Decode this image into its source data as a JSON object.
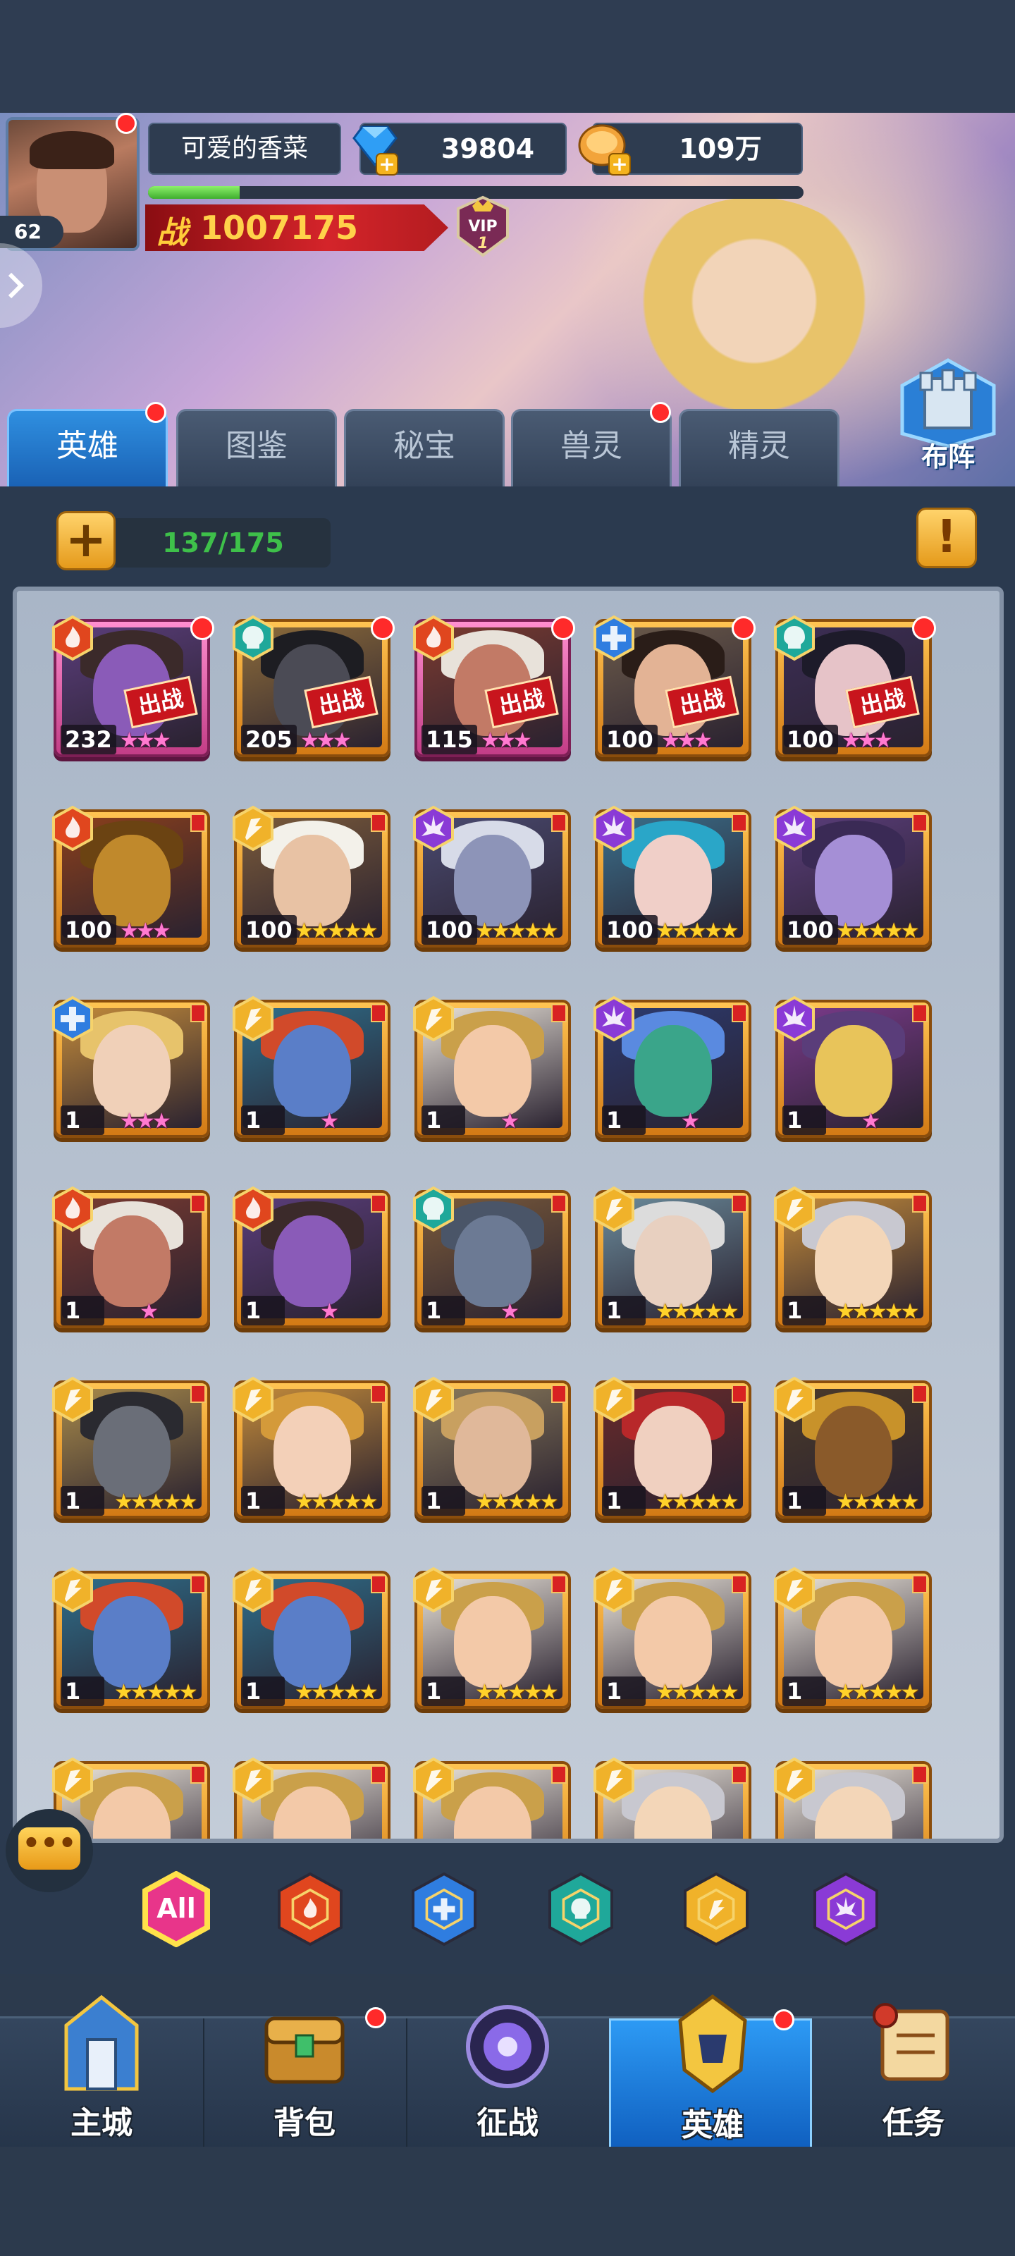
{
  "player": {
    "name": "可爱的香菜",
    "level": "62",
    "diamonds": "39804",
    "gold": "109万",
    "power_label": "战",
    "power": "1007175",
    "vip_label": "VIP",
    "vip_level": "1",
    "xp_progress": 0.14
  },
  "formation_label": "布阵",
  "tabs": [
    {
      "label": "英雄",
      "active": true,
      "badge": true
    },
    {
      "label": "图鉴",
      "active": false,
      "badge": false
    },
    {
      "label": "秘宝",
      "active": false,
      "badge": false
    },
    {
      "label": "兽灵",
      "active": false,
      "badge": true
    },
    {
      "label": "精灵",
      "active": false,
      "badge": false
    }
  ],
  "collection": {
    "add_label": "+",
    "count": "137/175",
    "info_label": "!"
  },
  "deploy_label": "出战",
  "heroes": [
    {
      "level": "232",
      "faction": "fire",
      "stars": 3,
      "star_color": "pink",
      "deployed": true,
      "dot": true,
      "frame": "purple",
      "skin": "#8a5bb8",
      "hair": "#3b2a2a",
      "bg": "#5a3d7a"
    },
    {
      "level": "205",
      "faction": "undead",
      "stars": 3,
      "star_color": "pink",
      "deployed": true,
      "dot": true,
      "frame": "gold",
      "skin": "#4b4b55",
      "hair": "#1d1d22",
      "bg": "#8c6b3a"
    },
    {
      "level": "115",
      "faction": "fire",
      "stars": 3,
      "star_color": "pink",
      "deployed": true,
      "dot": true,
      "frame": "purple",
      "skin": "#c27a66",
      "hair": "#e8e2da",
      "bg": "#7a3a30"
    },
    {
      "level": "100",
      "faction": "storm",
      "stars": 3,
      "star_color": "pink",
      "deployed": true,
      "dot": true,
      "frame": "gold",
      "skin": "#e3b395",
      "hair": "#2a1d18",
      "bg": "#6b5a4a"
    },
    {
      "level": "100",
      "faction": "undead",
      "stars": 3,
      "star_color": "pink",
      "deployed": true,
      "dot": true,
      "frame": "gold",
      "skin": "#e6c3c8",
      "hair": "#1d1b2a",
      "bg": "#3c2e55"
    },
    {
      "level": "100",
      "faction": "fire",
      "stars": 3,
      "star_color": "pink",
      "deployed": false,
      "dot": false,
      "frame": "gold",
      "skin": "#c0892c",
      "hair": "#6b4312",
      "bg": "#8a3f1c"
    },
    {
      "level": "100",
      "faction": "light",
      "stars": 5,
      "star_color": "gold",
      "deployed": false,
      "dot": false,
      "frame": "gold",
      "skin": "#e8c2a4",
      "hair": "#f3f1ea",
      "bg": "#7a5a3a"
    },
    {
      "level": "100",
      "faction": "shadow",
      "stars": 5,
      "star_color": "gold",
      "deployed": false,
      "dot": false,
      "frame": "gold",
      "skin": "#8d94b8",
      "hair": "#d7dbe8",
      "bg": "#4a4a70"
    },
    {
      "level": "100",
      "faction": "shadow",
      "stars": 5,
      "star_color": "gold",
      "deployed": false,
      "dot": false,
      "frame": "gold",
      "skin": "#f0cfc8",
      "hair": "#2aa6c8",
      "bg": "#3a6e8a"
    },
    {
      "level": "100",
      "faction": "shadow",
      "stars": 5,
      "star_color": "gold",
      "deployed": false,
      "dot": false,
      "frame": "gold",
      "skin": "#a58fd6",
      "hair": "#3a2a55",
      "bg": "#5a3d7a"
    },
    {
      "level": "1",
      "faction": "storm",
      "stars": 3,
      "star_color": "pink",
      "deployed": false,
      "dot": false,
      "frame": "gold",
      "skin": "#f0d0b8",
      "hair": "#e7c36b",
      "bg": "#c28a3a"
    },
    {
      "level": "1",
      "faction": "light",
      "stars": 1,
      "star_color": "pink",
      "deployed": false,
      "dot": false,
      "frame": "gold",
      "skin": "#5a7ec8",
      "hair": "#d14a2a",
      "bg": "#2e6e8a"
    },
    {
      "level": "1",
      "faction": "light",
      "stars": 1,
      "star_color": "pink",
      "deployed": false,
      "dot": false,
      "frame": "gold",
      "skin": "#f3c9a8",
      "hair": "#caa04a",
      "bg": "#e8e2d8"
    },
    {
      "level": "1",
      "faction": "shadow",
      "stars": 1,
      "star_color": "pink",
      "deployed": false,
      "dot": false,
      "frame": "gold",
      "skin": "#3aa58a",
      "hair": "#5a8ae0",
      "bg": "#2c3a6e"
    },
    {
      "level": "1",
      "faction": "shadow",
      "stars": 1,
      "star_color": "pink",
      "deployed": false,
      "dot": false,
      "frame": "gold",
      "skin": "#e8c45a",
      "hair": "#5a3d7a",
      "bg": "#7a3a8a"
    },
    {
      "level": "1",
      "faction": "fire",
      "stars": 1,
      "star_color": "pink",
      "deployed": false,
      "dot": false,
      "frame": "gold",
      "skin": "#c27a66",
      "hair": "#e8e2da",
      "bg": "#7a3a30"
    },
    {
      "level": "1",
      "faction": "fire",
      "stars": 1,
      "star_color": "pink",
      "deployed": false,
      "dot": false,
      "frame": "gold",
      "skin": "#8a5bb8",
      "hair": "#3b2a2a",
      "bg": "#5a3d7a"
    },
    {
      "level": "1",
      "faction": "undead",
      "stars": 1,
      "star_color": "pink",
      "deployed": false,
      "dot": false,
      "frame": "gold",
      "skin": "#6c7a94",
      "hair": "#4a5568",
      "bg": "#7a5a3a"
    },
    {
      "level": "1",
      "faction": "light",
      "stars": 5,
      "star_color": "gold",
      "deployed": false,
      "dot": false,
      "frame": "gold",
      "skin": "#e8d0c0",
      "hair": "#dcdcdc",
      "bg": "#6a8a9a"
    },
    {
      "level": "1",
      "faction": "light",
      "stars": 5,
      "star_color": "gold",
      "deployed": false,
      "dot": false,
      "frame": "gold",
      "skin": "#f3d6b8",
      "hair": "#c8c8d0",
      "bg": "#c28a3a"
    },
    {
      "level": "1",
      "faction": "light",
      "stars": 5,
      "star_color": "gold",
      "deployed": false,
      "dot": false,
      "frame": "gold",
      "skin": "#6a6e78",
      "hair": "#2a2a30",
      "bg": "#a88a4a"
    },
    {
      "level": "1",
      "faction": "light",
      "stars": 5,
      "star_color": "gold",
      "deployed": false,
      "dot": false,
      "frame": "gold",
      "skin": "#f3d0b8",
      "hair": "#d49a3a",
      "bg": "#c28a3a"
    },
    {
      "level": "1",
      "faction": "light",
      "stars": 5,
      "star_color": "gold",
      "deployed": false,
      "dot": false,
      "frame": "gold",
      "skin": "#e0b89a",
      "hair": "#c8a060",
      "bg": "#8a7a5a"
    },
    {
      "level": "1",
      "faction": "light",
      "stars": 5,
      "star_color": "gold",
      "deployed": false,
      "dot": false,
      "frame": "gold",
      "skin": "#f0d0c0",
      "hair": "#b8282a",
      "bg": "#6a2a2a"
    },
    {
      "level": "1",
      "faction": "light",
      "stars": 5,
      "star_color": "gold",
      "deployed": false,
      "dot": false,
      "frame": "gold",
      "skin": "#8a5a2a",
      "hair": "#c8922a",
      "bg": "#4a3a2a"
    },
    {
      "level": "1",
      "faction": "light",
      "stars": 5,
      "star_color": "gold",
      "deployed": false,
      "dot": false,
      "frame": "gold",
      "skin": "#5a7ec8",
      "hair": "#d14a2a",
      "bg": "#2e6e8a"
    },
    {
      "level": "1",
      "faction": "light",
      "stars": 5,
      "star_color": "gold",
      "deployed": false,
      "dot": false,
      "frame": "gold",
      "skin": "#5a7ec8",
      "hair": "#d14a2a",
      "bg": "#2e6e8a"
    },
    {
      "level": "1",
      "faction": "light",
      "stars": 5,
      "star_color": "gold",
      "deployed": false,
      "dot": false,
      "frame": "gold",
      "skin": "#f3c9a8",
      "hair": "#caa04a",
      "bg": "#e8e2d8"
    },
    {
      "level": "1",
      "faction": "light",
      "stars": 5,
      "star_color": "gold",
      "deployed": false,
      "dot": false,
      "frame": "gold",
      "skin": "#f3c9a8",
      "hair": "#caa04a",
      "bg": "#e8e2d8"
    },
    {
      "level": "1",
      "faction": "light",
      "stars": 5,
      "star_color": "gold",
      "deployed": false,
      "dot": false,
      "frame": "gold",
      "skin": "#f3c9a8",
      "hair": "#caa04a",
      "bg": "#e8e2d8"
    },
    {
      "level": "",
      "faction": "light",
      "stars": 0,
      "star_color": "gold",
      "deployed": false,
      "dot": false,
      "frame": "gold",
      "skin": "#f3c9a8",
      "hair": "#caa04a",
      "bg": "#e8e2d8"
    },
    {
      "level": "",
      "faction": "light",
      "stars": 0,
      "star_color": "gold",
      "deployed": false,
      "dot": false,
      "frame": "gold",
      "skin": "#f3c9a8",
      "hair": "#caa04a",
      "bg": "#e8e2d8"
    },
    {
      "level": "",
      "faction": "light",
      "stars": 0,
      "star_color": "gold",
      "deployed": false,
      "dot": false,
      "frame": "gold",
      "skin": "#f3c9a8",
      "hair": "#caa04a",
      "bg": "#e8e2d8"
    },
    {
      "level": "",
      "faction": "light",
      "stars": 0,
      "star_color": "gold",
      "deployed": false,
      "dot": false,
      "frame": "gold",
      "skin": "#f3d6b8",
      "hair": "#c8c8d0",
      "bg": "#e8e2d8"
    },
    {
      "level": "",
      "faction": "light",
      "stars": 0,
      "star_color": "gold",
      "deployed": false,
      "dot": false,
      "frame": "gold",
      "skin": "#f3d6b8",
      "hair": "#c8c8d0",
      "bg": "#e8e2d8"
    }
  ],
  "filters": [
    {
      "name": "all",
      "label": "All",
      "color": "#e8358a",
      "selected": true
    },
    {
      "name": "fire",
      "label": "",
      "color": "#e0461e",
      "selected": false
    },
    {
      "name": "storm",
      "label": "",
      "color": "#2f7de0",
      "selected": false
    },
    {
      "name": "undead",
      "label": "",
      "color": "#1fa89a",
      "selected": false
    },
    {
      "name": "light",
      "label": "",
      "color": "#f0b22a",
      "selected": false
    },
    {
      "name": "shadow",
      "label": "",
      "color": "#8a3ad6",
      "selected": false
    }
  ],
  "faction_colors": {
    "fire": "#e0461e",
    "storm": "#2f7de0",
    "undead": "#1fa89a",
    "light": "#f0b22a",
    "shadow": "#8a3ad6"
  },
  "chat_icon": "chat-bubble-icon",
  "nav": [
    {
      "label": "主城",
      "icon": "castle-icon",
      "active": false,
      "badge": false
    },
    {
      "label": "背包",
      "icon": "treasure-chest-icon",
      "active": false,
      "badge": true
    },
    {
      "label": "征战",
      "icon": "portal-icon",
      "active": false,
      "badge": false
    },
    {
      "label": "英雄",
      "icon": "hero-helmet-icon",
      "active": true,
      "badge": true
    },
    {
      "label": "任务",
      "icon": "scroll-icon",
      "active": false,
      "badge": false
    }
  ]
}
